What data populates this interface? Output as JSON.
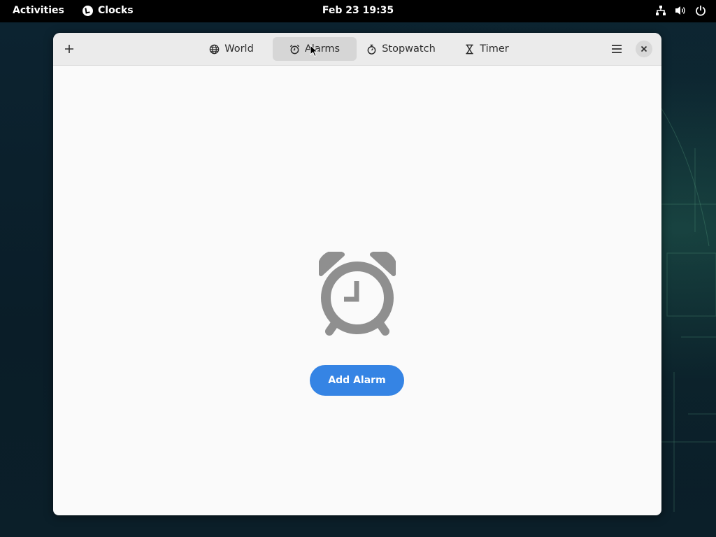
{
  "topbar": {
    "activities": "Activities",
    "app_name": "Clocks",
    "datetime": "Feb 23  19:35",
    "tray_icons": [
      "network-icon",
      "volume-icon",
      "power-icon"
    ]
  },
  "window": {
    "tabs": [
      {
        "label": "World",
        "icon": "globe-icon",
        "active": false
      },
      {
        "label": "Alarms",
        "icon": "alarm-clock-icon",
        "active": true
      },
      {
        "label": "Stopwatch",
        "icon": "stopwatch-icon",
        "active": false
      },
      {
        "label": "Timer",
        "icon": "hourglass-icon",
        "active": false
      }
    ],
    "empty_state": {
      "icon": "alarm-clock-icon",
      "button_label": "Add Alarm"
    }
  },
  "colors": {
    "accent": "#3584e4",
    "topbar": "#000000",
    "headerbar": "#ebebeb",
    "content_bg": "#fafafa",
    "icon_gray": "#8f8f8f"
  }
}
